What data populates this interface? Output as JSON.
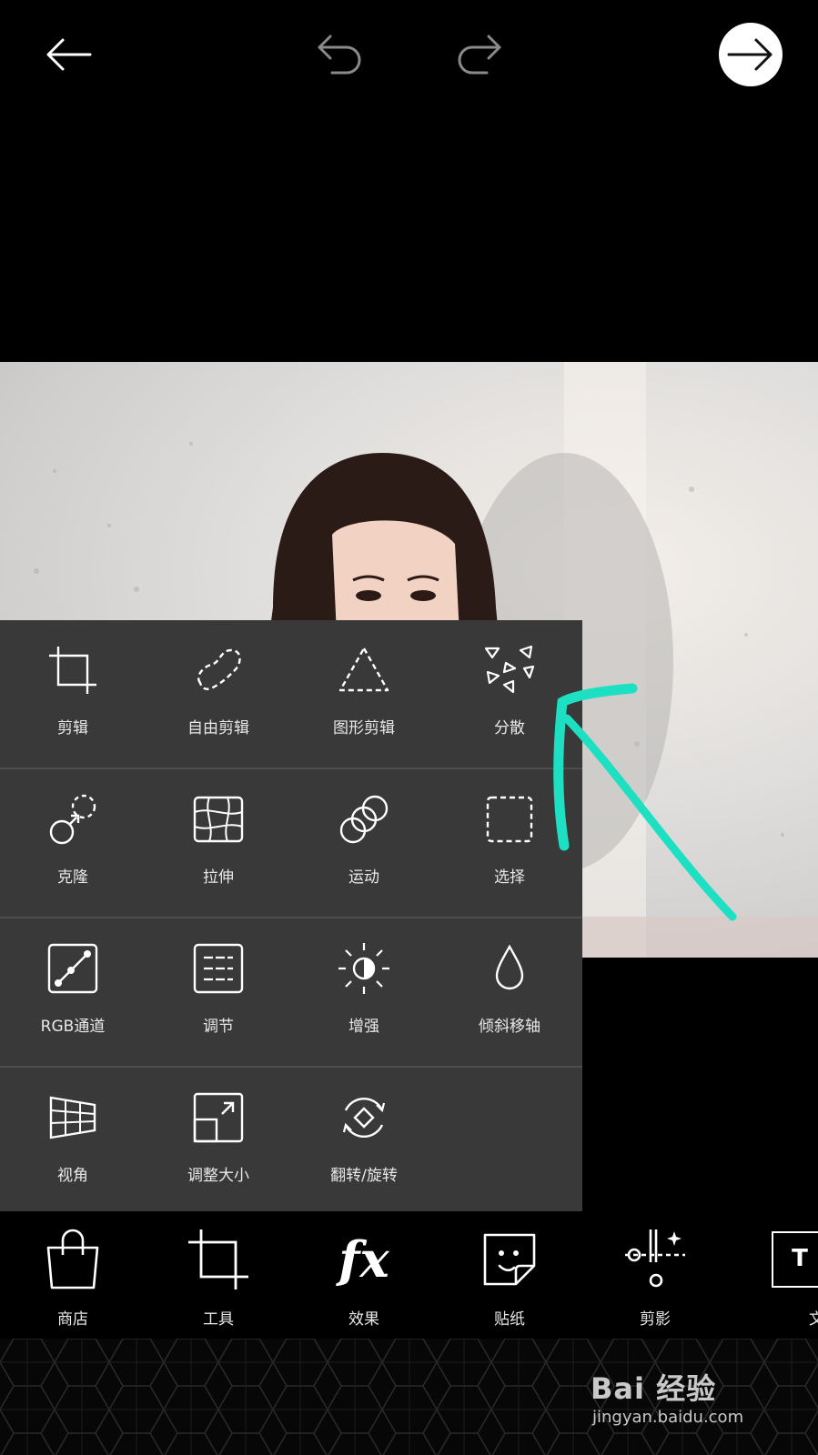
{
  "tools": [
    [
      {
        "label": "剪辑",
        "icon": "crop-icon"
      },
      {
        "label": "自由剪辑",
        "icon": "freeform-crop-icon"
      },
      {
        "label": "图形剪辑",
        "icon": "shape-crop-icon"
      },
      {
        "label": "分散",
        "icon": "dispersion-icon"
      }
    ],
    [
      {
        "label": "克隆",
        "icon": "clone-icon"
      },
      {
        "label": "拉伸",
        "icon": "stretch-icon"
      },
      {
        "label": "运动",
        "icon": "motion-icon"
      },
      {
        "label": "选择",
        "icon": "selection-icon"
      }
    ],
    [
      {
        "label": "RGB通道",
        "icon": "rgb-curves-icon"
      },
      {
        "label": "调节",
        "icon": "adjust-icon"
      },
      {
        "label": "增强",
        "icon": "enhance-icon"
      },
      {
        "label": "倾斜移轴",
        "icon": "tilt-shift-icon"
      }
    ],
    [
      {
        "label": "视角",
        "icon": "perspective-icon"
      },
      {
        "label": "调整大小",
        "icon": "resize-icon"
      },
      {
        "label": "翻转/旋转",
        "icon": "flip-rotate-icon"
      }
    ]
  ],
  "bottom_nav": [
    {
      "label": "商店",
      "icon": "shopping-bag-icon"
    },
    {
      "label": "工具",
      "icon": "crop-icon"
    },
    {
      "label": "效果",
      "icon": "fx-icon"
    },
    {
      "label": "贴纸",
      "icon": "sticker-icon"
    },
    {
      "label": "剪影",
      "icon": "cutout-icon"
    },
    {
      "label": "文本",
      "icon": "text-icon"
    }
  ],
  "fx_glyph": "fx",
  "text_glyph": "T",
  "watermark": {
    "logo": "Bai 经验",
    "url": "jingyan.baidu.com"
  },
  "colors": {
    "panel": "#393939",
    "annotation_arrow": "#1de0c3",
    "background": "#000000"
  }
}
